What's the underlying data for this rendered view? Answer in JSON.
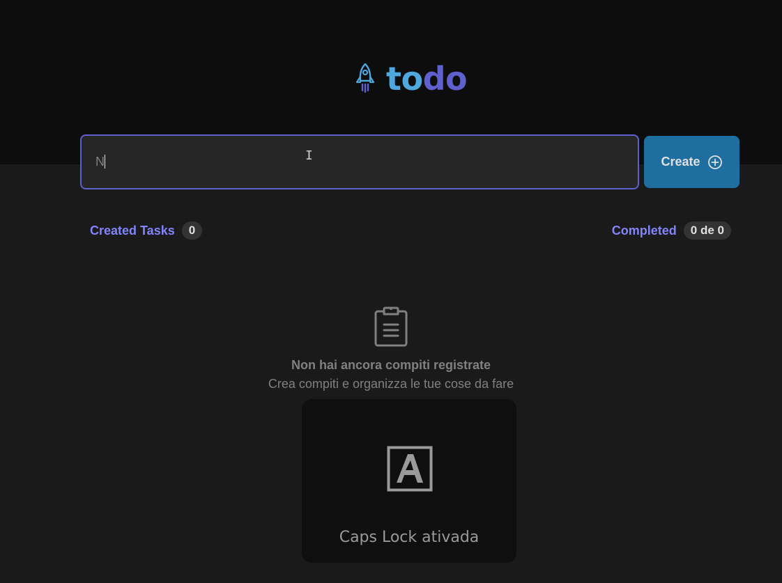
{
  "app": {
    "logo_part1": "to",
    "logo_part2": "do",
    "logo_icon": "rocket-icon"
  },
  "task_input": {
    "value": "N",
    "placeholder": ""
  },
  "create_button": {
    "label": "Create",
    "icon": "plus-circle-icon"
  },
  "counters": {
    "created_label": "Created Tasks",
    "created_count": "0",
    "completed_label": "Completed",
    "completed_count": "0 de 0"
  },
  "empty_state": {
    "icon": "clipboard-icon",
    "title": "Non hai ancora compiti registrate",
    "subtitle": "Crea compiti e organizza le tue cose da fare"
  },
  "caps_lock_toast": {
    "icon": "caps-lock-icon",
    "text": "Caps Lock ativada"
  },
  "colors": {
    "header_bg": "#0d0d0d",
    "body_bg": "#1a1a1a",
    "accent_blue": "#4ea8de",
    "accent_purple": "#5e60ce",
    "counter_purple": "#8284fa",
    "button_bg": "#1e6f9f"
  }
}
